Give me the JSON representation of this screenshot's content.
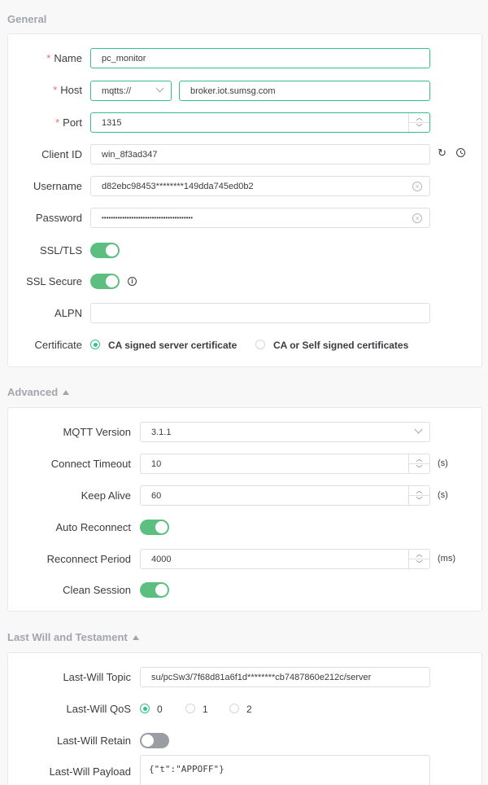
{
  "general": {
    "title": "General",
    "name": {
      "label": "Name",
      "required": "*",
      "value": "pc_monitor"
    },
    "host": {
      "label": "Host",
      "required": "*",
      "protocol": "mqtts://",
      "value": "broker.iot.sumsg.com"
    },
    "port": {
      "label": "Port",
      "required": "*",
      "value": "1315"
    },
    "client_id": {
      "label": "Client ID",
      "value": "win_8f3ad347",
      "refresh_icon": "refresh-icon",
      "history_icon": "clock-icon"
    },
    "username": {
      "label": "Username",
      "value": "d82ebc98453********149dda745ed0b2"
    },
    "password": {
      "label": "Password",
      "value": "••••••••••••••••••••••••••••••••••••••••"
    },
    "ssl_tls": {
      "label": "SSL/TLS",
      "on": true
    },
    "ssl_secure": {
      "label": "SSL Secure",
      "on": true
    },
    "alpn": {
      "label": "ALPN",
      "value": ""
    },
    "certificate": {
      "label": "Certificate",
      "option1": "CA signed server certificate",
      "option2": "CA or Self signed certificates",
      "selected": "option1"
    }
  },
  "advanced": {
    "title": "Advanced",
    "mqtt_version": {
      "label": "MQTT Version",
      "value": "3.1.1"
    },
    "connect_timeout": {
      "label": "Connect Timeout",
      "value": "10",
      "unit": "(s)"
    },
    "keep_alive": {
      "label": "Keep Alive",
      "value": "60",
      "unit": "(s)"
    },
    "auto_reconnect": {
      "label": "Auto Reconnect",
      "on": true
    },
    "reconnect_period": {
      "label": "Reconnect Period",
      "value": "4000",
      "unit": "(ms)"
    },
    "clean_session": {
      "label": "Clean Session",
      "on": true
    }
  },
  "last_will": {
    "title": "Last Will and Testament",
    "topic": {
      "label": "Last-Will Topic",
      "value": "su/pcSw3/7f68d81a6f1d********cb7487860e212c/server"
    },
    "qos": {
      "label": "Last-Will QoS",
      "options": [
        "0",
        "1",
        "2"
      ],
      "selected": "0"
    },
    "retain": {
      "label": "Last-Will Retain",
      "on": false
    },
    "payload": {
      "label": "Last-Will Payload",
      "value": "{\"t\":\"APPOFF\"}"
    }
  },
  "colors": {
    "accent": "#34c388",
    "toggle_on": "#5cbf80",
    "toggle_off": "#9a9da3",
    "required": "#f56c6c"
  }
}
